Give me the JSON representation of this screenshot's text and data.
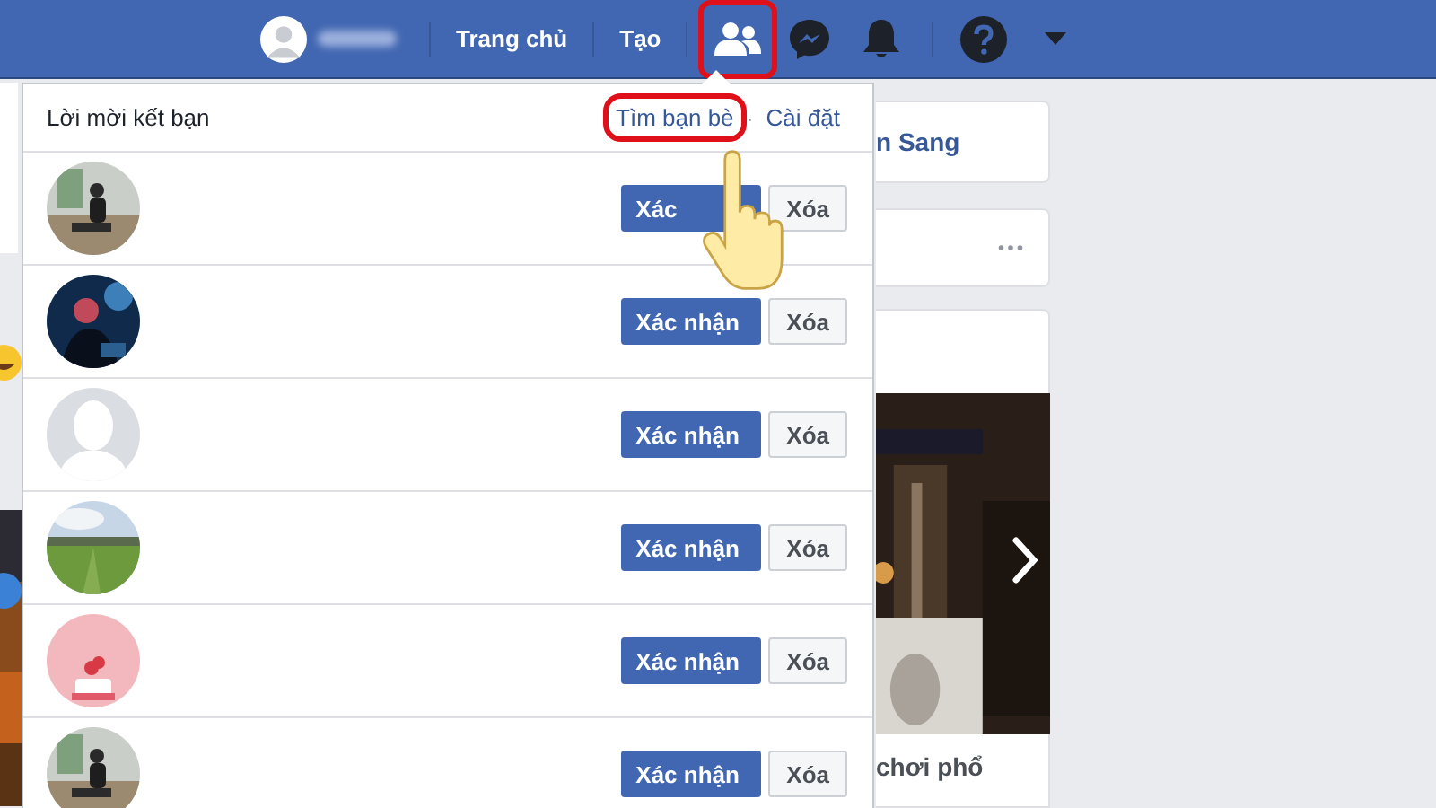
{
  "top_bar": {
    "nav_links": [
      "Trang chủ",
      "Tạo"
    ],
    "icons": [
      {
        "kind": "friends",
        "highlighted": true
      },
      {
        "kind": "messenger",
        "highlighted": false
      },
      {
        "kind": "bell",
        "highlighted": false
      },
      {
        "kind": "help",
        "highlighted": false
      },
      {
        "kind": "caret",
        "highlighted": false
      }
    ]
  },
  "friend_requests": {
    "title": "Lời mời kết bạn",
    "separator": "·",
    "links": [
      {
        "label": "Tìm bạn bè",
        "highlighted": true
      },
      {
        "label": "Cài đặt",
        "highlighted": false
      }
    ],
    "requests": [
      {
        "confirm": "Xác",
        "delete": "Xóa"
      },
      {
        "confirm": "Xác nhận",
        "delete": "Xóa"
      },
      {
        "kind": "default",
        "confirm": "Xác nhận",
        "delete": "Xóa"
      },
      {
        "confirm": "Xác nhận",
        "delete": "Xóa"
      },
      {
        "confirm": "Xác nhận",
        "delete": "Xóa"
      },
      {
        "confirm": "Xác nhận",
        "delete": "Xóa"
      }
    ]
  },
  "right_column": {
    "name_card": "n Sang",
    "video_caption": "chơi phổ"
  }
}
